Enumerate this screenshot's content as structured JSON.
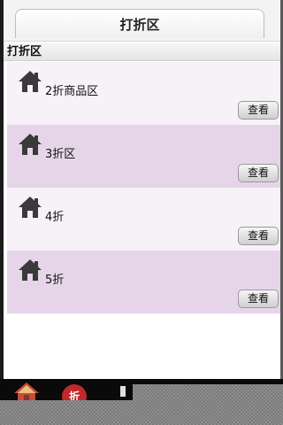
{
  "header": {
    "title": "打折区"
  },
  "section": {
    "title": "打折区"
  },
  "items": [
    {
      "label": "2折商品区",
      "button": "查看",
      "icon": "home-icon"
    },
    {
      "label": "3折区",
      "button": "查看",
      "icon": "home-icon"
    },
    {
      "label": "4折",
      "button": "查看",
      "icon": "home-icon"
    },
    {
      "label": "5折",
      "button": "查看",
      "icon": "home-icon"
    }
  ],
  "tabbar": {
    "discount_badge": "折"
  },
  "colors": {
    "row_light": "#f7f1f8",
    "row_dark": "#e6d5e9",
    "badge_red": "#c02a2a"
  }
}
